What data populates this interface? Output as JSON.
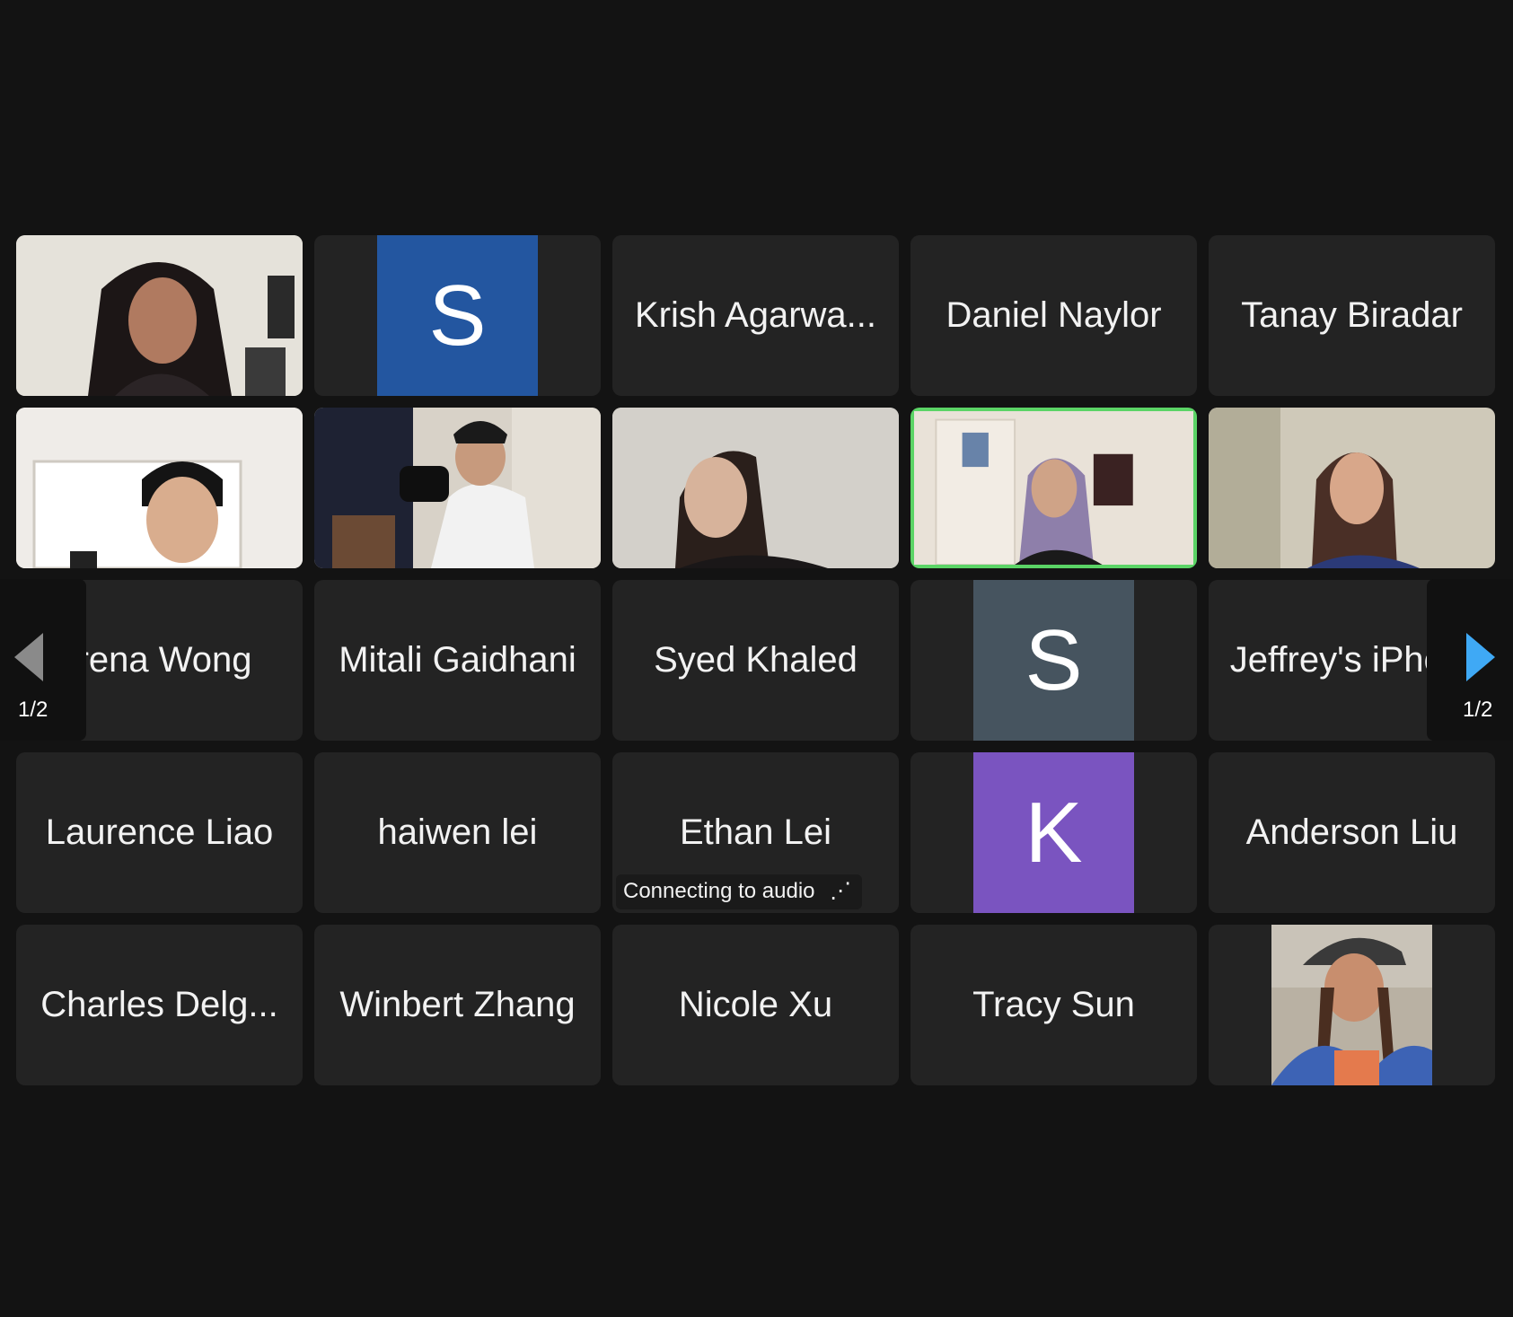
{
  "meeting": {
    "page_indicator_left": "1/2",
    "page_indicator_right": "1/2",
    "active_speaker_color": "#5bd466"
  },
  "tiles": {
    "t_krish": "Krish Agarwa...",
    "t_daniel": "Daniel Naylor",
    "t_tanay": "Tanay Biradar",
    "t_irena": "Irena Wong",
    "t_mitali": "Mitali Gaidhani",
    "t_syed": "Syed Khaled",
    "t_jeffrey": "Jeffrey's iPho...",
    "t_laurence": "Laurence Liao",
    "t_haiwen": "haiwen lei",
    "t_ethan": "Ethan Lei",
    "t_anderson": "Anderson Liu",
    "t_charles": "Charles Delg...",
    "t_winbert": "Winbert Zhang",
    "t_nicole": "Nicole Xu",
    "t_tracy": "Tracy Sun"
  },
  "avatars": {
    "s_blue": {
      "letter": "S",
      "color": "#2356a0"
    },
    "s_gray": {
      "letter": "S",
      "color": "#46545f"
    },
    "k_purple": {
      "letter": "K",
      "color": "#7a54c0"
    }
  },
  "status": {
    "ethan_audio": "Connecting to audio"
  },
  "icons": {
    "prev_page": "chevron-left-icon",
    "next_page": "chevron-right-icon"
  }
}
